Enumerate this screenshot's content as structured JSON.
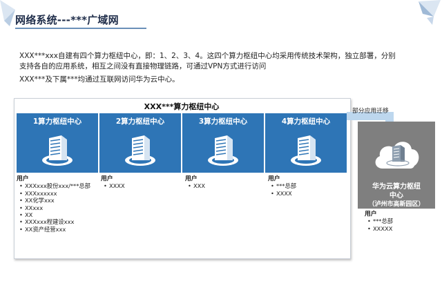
{
  "header": {
    "title": "网络系统---***广域网"
  },
  "intro": {
    "line1": "XXX***xxx自建有四个算力枢纽中心，即：1、2、3、4。这四个算力枢纽中心均采用传统技术架构，独立部署，分别",
    "line2": "支持各自的应用系统，相互之间没有直接物理链路，可通过VPN方式进行访问",
    "line3": "XXX***及下属***均通过互联网访问华为云中心。"
  },
  "diagram": {
    "frame_title": "XXX***算力枢纽中心",
    "migration_label": "部分应用迁移",
    "hubs": [
      {
        "label": "1算力枢纽中心",
        "users_heading": "用户",
        "users": [
          "XXXxxx股份xxx/***总部",
          "XXXxxxxxx",
          "XX化学xxx",
          "XXxxx",
          "XX",
          "XXXxxx程建设xxx",
          "XX资产经营xxx"
        ]
      },
      {
        "label": "2算力枢纽中心",
        "users_heading": "用户",
        "users": [
          "XXXX"
        ]
      },
      {
        "label": "3算力枢纽中心",
        "users_heading": "用户",
        "users": [
          "XXX"
        ]
      },
      {
        "label": "4算力枢纽中心",
        "users_heading": "用户",
        "users": [
          "***总部",
          "XXXX"
        ]
      }
    ],
    "cloud": {
      "title_line1": "华为云算力枢纽",
      "title_line2": "中心",
      "title_line3": "（泸州市高新园区）",
      "users_heading": "用户",
      "users": [
        "***总部",
        "XXXXX"
      ]
    }
  },
  "colors": {
    "hub_blue": "#2e75b6",
    "cloud_gray": "#7f7f7f",
    "arrow_blue": "#bdd7ee"
  },
  "icons": {
    "hub_icon": "datacenter-building-icon",
    "cloud_icon": "cloud-server-icon",
    "arrow": "migration-arrow"
  }
}
